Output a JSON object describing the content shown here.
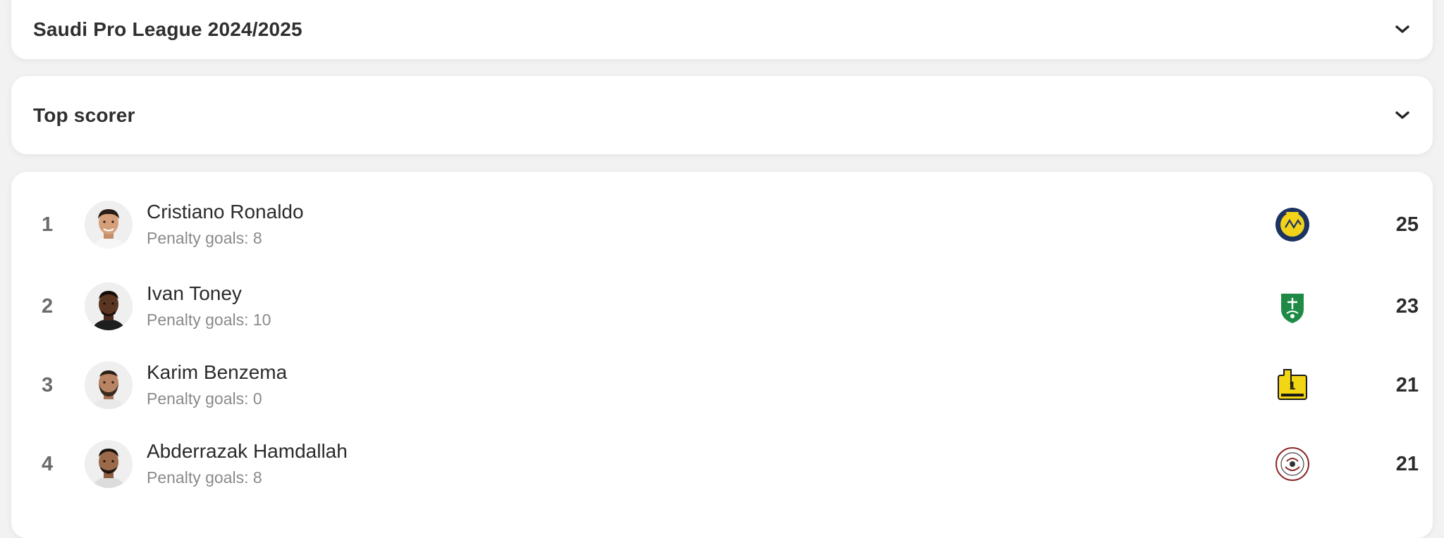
{
  "season_selector": {
    "label": "Saudi Pro League 2024/2025",
    "icon": "chevron-down-icon"
  },
  "stat_selector": {
    "label": "Top scorer",
    "icon": "chevron-down-icon"
  },
  "players": [
    {
      "rank": "1",
      "name": "Cristiano Ronaldo",
      "penalty_text": "Penalty goals: 8",
      "goals": "25",
      "club_icon": "al-nassr-crest-icon",
      "club_color": "#1d3461"
    },
    {
      "rank": "2",
      "name": "Ivan Toney",
      "penalty_text": "Penalty goals: 10",
      "goals": "23",
      "club_icon": "al-ahli-crest-icon",
      "club_color": "#1e8a45"
    },
    {
      "rank": "3",
      "name": "Karim Benzema",
      "penalty_text": "Penalty goals: 0",
      "goals": "21",
      "club_icon": "al-ittihad-crest-icon",
      "club_color": "#f2d513"
    },
    {
      "rank": "4",
      "name": "Abderrazak Hamdallah",
      "penalty_text": "Penalty goals: 8",
      "goals": "21",
      "club_icon": "al-shabab-crest-icon",
      "club_color": "#8b2a2a"
    }
  ]
}
